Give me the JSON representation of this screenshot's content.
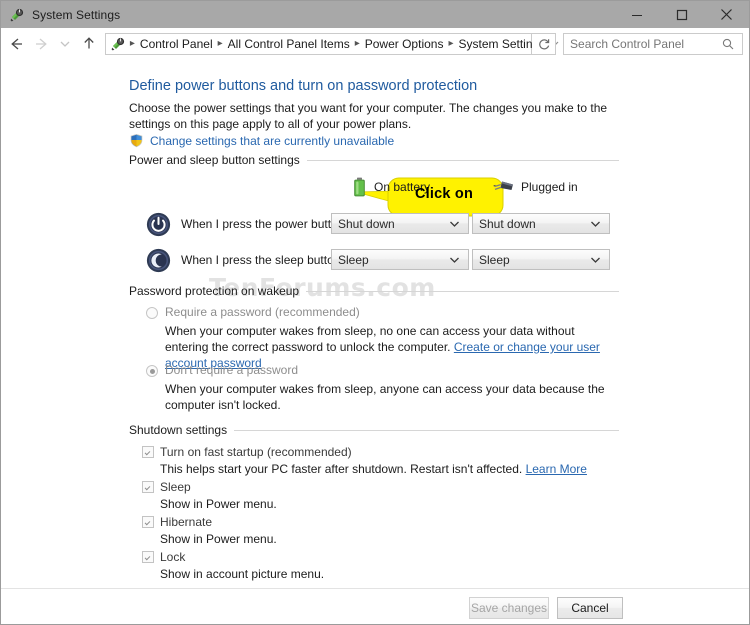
{
  "window": {
    "title": "System Settings",
    "app_icon": "control-panel-power-icon",
    "minimize_label": "Minimize",
    "maximize_label": "Maximize",
    "close_label": "Close"
  },
  "nav": {
    "back_label": "Back",
    "forward_label": "Forward",
    "recent_label": "Recent locations",
    "up_label": "Up one level",
    "breadcrumbs": [
      "Control Panel",
      "All Control Panel Items",
      "Power Options",
      "System Settings"
    ],
    "separator": "▸",
    "refresh_label": "Refresh",
    "search_placeholder": "Search Control Panel",
    "search_value": ""
  },
  "page": {
    "heading": "Define power buttons and turn on password protection",
    "description": "Choose the power settings that you want for your computer. The changes you make to the settings on this page apply to all of your power plans.",
    "uac_link": "Change settings that are currently unavailable",
    "watermark": "TenForums.com"
  },
  "callout": {
    "text": "Click on",
    "fill_color": "#FFF200",
    "border_color": "#C8C000"
  },
  "mode_header": {
    "battery": "On battery",
    "plugged_in": "Plugged in"
  },
  "sections": {
    "power_sleep": {
      "label": "Power and sleep button settings",
      "rows": [
        {
          "icon": "power-button-icon",
          "label": "When I press the power button:",
          "battery_value": "Shut down",
          "plugged_value": "Shut down"
        },
        {
          "icon": "sleep-moon-icon",
          "label": "When I press the sleep button:",
          "battery_value": "Sleep",
          "plugged_value": "Sleep"
        }
      ]
    },
    "password_protection": {
      "label": "Password protection on wakeup",
      "options": [
        {
          "label": "Require a password (recommended)",
          "selected": false,
          "description": "When your computer wakes from sleep, no one can access your data without entering the correct password to unlock the computer.",
          "link": "Create or change your user account password"
        },
        {
          "label": "Don't require a password",
          "selected": true,
          "description": "When your computer wakes from sleep, anyone can access your data because the computer isn't locked.",
          "link": ""
        }
      ]
    },
    "shutdown": {
      "label": "Shutdown settings",
      "items": [
        {
          "label": "Turn on fast startup (recommended)",
          "checked": true,
          "description": "This helps start your PC faster after shutdown. Restart isn't affected.",
          "link": "Learn More"
        },
        {
          "label": "Sleep",
          "checked": true,
          "description": "Show in Power menu.",
          "link": ""
        },
        {
          "label": "Hibernate",
          "checked": true,
          "description": "Show in Power menu.",
          "link": ""
        },
        {
          "label": "Lock",
          "checked": true,
          "description": "Show in account picture menu.",
          "link": ""
        }
      ]
    }
  },
  "footer": {
    "save_label": "Save changes",
    "cancel_label": "Cancel"
  }
}
